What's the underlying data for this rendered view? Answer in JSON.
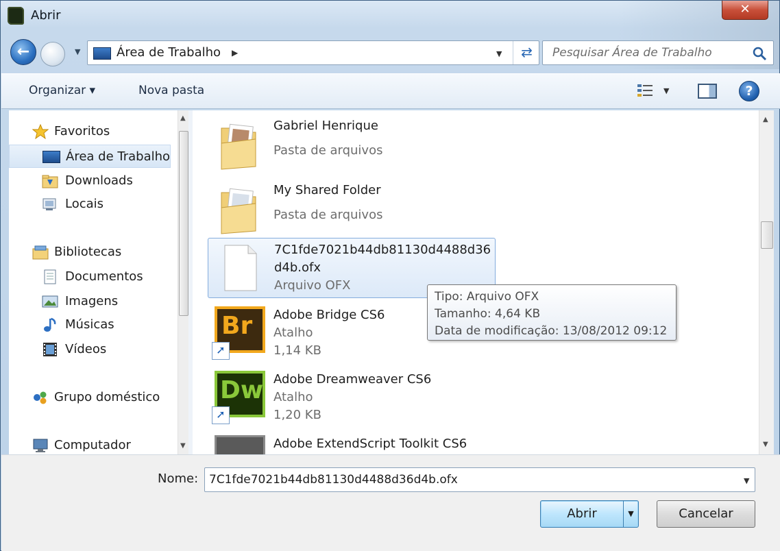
{
  "window": {
    "title": "Abrir",
    "close_label": "✕"
  },
  "nav": {
    "address_path": "Área de Trabalho",
    "search_placeholder": "Pesquisar Área de Trabalho"
  },
  "toolbar": {
    "organize_label": "Organizar ▾",
    "new_folder_label": "Nova pasta",
    "help_label": "?"
  },
  "sidebar": {
    "items": [
      {
        "label": "Favoritos",
        "icon": "star-icon"
      },
      {
        "label": "Área de Trabalho",
        "icon": "desktop-icon",
        "selected": true
      },
      {
        "label": "Downloads",
        "icon": "downloads-folder-icon"
      },
      {
        "label": "Locais",
        "icon": "recent-places-icon"
      },
      {
        "label": "Bibliotecas",
        "icon": "libraries-icon"
      },
      {
        "label": "Documentos",
        "icon": "documents-icon"
      },
      {
        "label": "Imagens",
        "icon": "pictures-icon"
      },
      {
        "label": "Músicas",
        "icon": "music-icon"
      },
      {
        "label": "Vídeos",
        "icon": "videos-icon"
      },
      {
        "label": "Grupo doméstico",
        "icon": "homegroup-icon"
      },
      {
        "label": "Computador",
        "icon": "computer-icon"
      }
    ]
  },
  "files": [
    {
      "name": "Gabriel Henrique",
      "type": "Pasta de arquivos",
      "icon": "folder-icon"
    },
    {
      "name": "My Shared Folder",
      "type": "Pasta de arquivos",
      "icon": "folder-icon"
    },
    {
      "name": "7C1fde7021b44db81130d4488d36d4b.ofx",
      "type": "Arquivo OFX",
      "icon": "document-icon",
      "selected": true
    },
    {
      "name": "Adobe Bridge CS6",
      "type": "Atalho",
      "size": "1,14 KB",
      "icon": "adobe-bridge-icon",
      "badge": "Br"
    },
    {
      "name": "Adobe Dreamweaver CS6",
      "type": "Atalho",
      "size": "1,20 KB",
      "icon": "adobe-dreamweaver-icon",
      "badge": "Dw"
    },
    {
      "name": "Adobe ExtendScript Toolkit CS6",
      "icon": "adobe-extendscript-icon"
    }
  ],
  "tooltip": {
    "line1": "Tipo: Arquivo OFX",
    "line2": "Tamanho: 4,64 KB",
    "line3": "Data de modificação: 13/08/2012 09:12"
  },
  "footer": {
    "name_label": "Nome:",
    "filename_value": "7C1fde7021b44db81130d4488d36d4b.ofx",
    "open_label": "Abrir",
    "cancel_label": "Cancelar"
  },
  "colors": {
    "selection_bg": "#dce9f8",
    "selection_border": "#84acdd",
    "title_close": "#c9503a",
    "bridge_brand": "#f2a81d",
    "dreamweaver_brand": "#8ac83a"
  }
}
